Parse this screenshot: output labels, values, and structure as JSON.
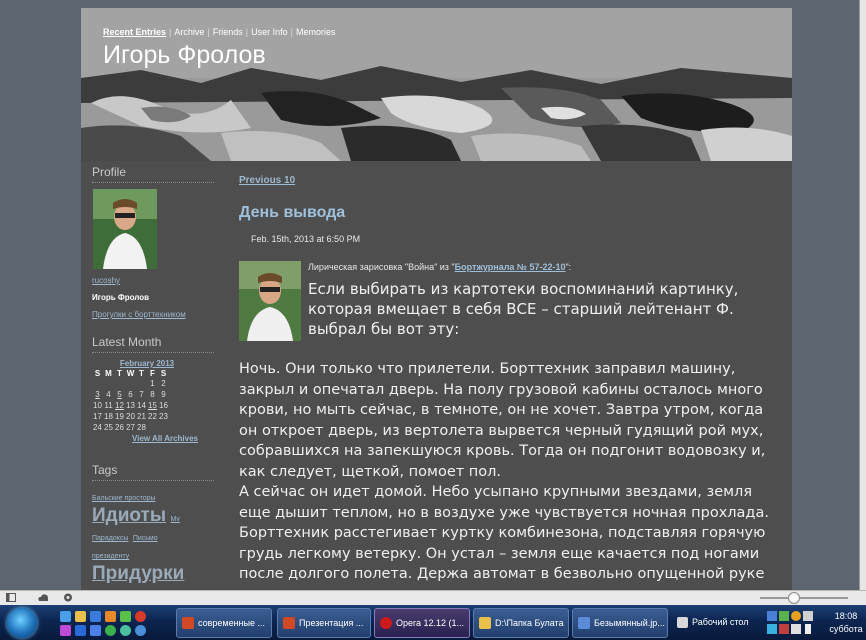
{
  "nav": {
    "items": [
      "Recent Entries",
      "Archive",
      "Friends",
      "User Info",
      "Memories"
    ],
    "separator": "|"
  },
  "site": {
    "title": "Игорь Фролов"
  },
  "sidebar": {
    "profile_heading": "Profile",
    "userlink": "rucoshy",
    "username": "Игорь Фролов",
    "profile_link": "Прогулки с борттехником",
    "latest_month_heading": "Latest Month",
    "calendar": {
      "month_label": "February 2013",
      "weekdays": [
        "S",
        "M",
        "T",
        "W",
        "T",
        "F",
        "S"
      ],
      "rows": [
        [
          "",
          "",
          "",
          "",
          "",
          "1",
          "2"
        ],
        [
          "3",
          "4",
          "5",
          "6",
          "7",
          "8",
          "9"
        ],
        [
          "10",
          "11",
          "12",
          "13",
          "14",
          "15",
          "16"
        ],
        [
          "17",
          "18",
          "19",
          "20",
          "21",
          "22",
          "23"
        ],
        [
          "24",
          "25",
          "26",
          "27",
          "28",
          "",
          ""
        ]
      ],
      "view_all": "View All Archives"
    },
    "tags_heading": "Tags",
    "tags": {
      "t1": "Бальские просторы",
      "t2": "Идиоты",
      "t3": "Mv",
      "t4": "Парадоксы",
      "t5": "Письмо",
      "t6": "президенту",
      "t7": "Придурки"
    }
  },
  "main": {
    "prev_link": "Previous 10",
    "post_title": "День вывода",
    "post_date": "Feb. 15th, 2013 at 6:50 PM",
    "caption_prefix": "Лирическая зарисовка \"Война\" из \"",
    "caption_link": "Бортжурнала № 57-22-10",
    "caption_suffix": "\":",
    "lead": "Если выбирать из картотеки воспоминаний картинку, которая вмещает в себя ВСЕ – старший лейтенант Ф. выбрал бы вот эту:",
    "paragraph1": "Ночь. Они только что прилетели. Борттехник заправил машину, закрыл и опечатал дверь. На полу грузовой кабины осталось много крови, но мыть сейчас, в темноте, он не хочет. Завтра утром, когда он откроет дверь, из вертолета вырвется черный гудящий рой мух, собравшихся на запекшуюся кровь. Тогда он подгонит водовозку и, как следует, щеткой, помоет пол.",
    "paragraph2": "А сейчас он идет домой. Небо усыпано крупными звездами, земля еще дышит теплом, но в воздухе уже чувствуется ночная прохлада. Борттехник расстегивает куртку комбинезона, подставляя горячую грудь легкому ветерку. Он устал – земля еще качается под ногами после долгого полета. Держа автомат в безвольно опущенной руке"
  },
  "taskbar": {
    "buttons": [
      {
        "label": "современные ...",
        "color": "#d04a25"
      },
      {
        "label": "Презентация ...",
        "color": "#d04a25"
      },
      {
        "label": "Opera 12.12 (1...",
        "color": "#cc1a1a"
      },
      {
        "label": "D:\\Папка Булата",
        "color": "#e8c04a"
      },
      {
        "label": "Безымянный.jp...",
        "color": "#5a8ad8"
      }
    ],
    "desktop_label": "Рабочий стол",
    "clock_time": "18:08",
    "clock_day": "суббота"
  }
}
